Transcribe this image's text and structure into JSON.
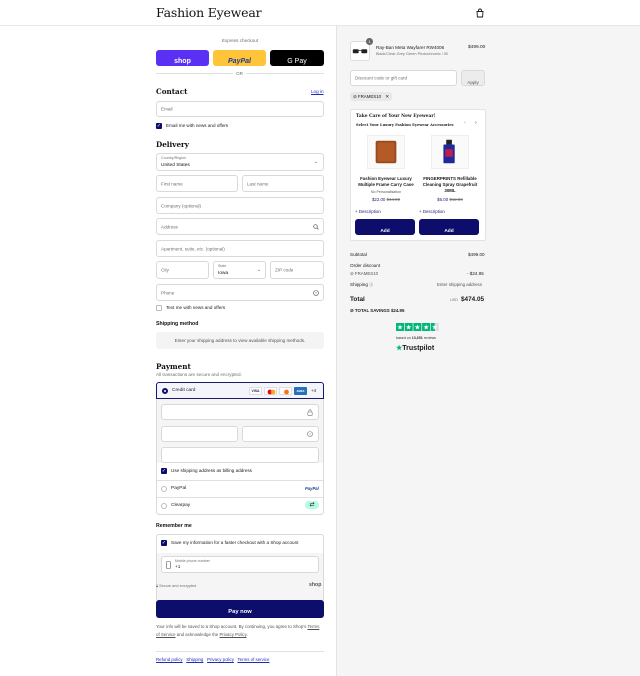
{
  "header": {
    "logo": "Fashion Eyewear",
    "bag_icon": "shopping-bag-icon"
  },
  "express": {
    "label": "Express checkout",
    "shop": "shop",
    "paypal": "PayPal",
    "gpay": "G Pay",
    "or": "OR"
  },
  "contact": {
    "title": "Contact",
    "login": "Log in",
    "email_placeholder": "Email",
    "news_label": "Email me with news and offers"
  },
  "delivery": {
    "title": "Delivery",
    "country_label": "Country/Region",
    "country": "United States",
    "first_name": "First name",
    "last_name": "Last name",
    "company": "Company (optional)",
    "address": "Address",
    "apartment": "Apartment, suite, etc. (optional)",
    "city": "City",
    "state_label": "State",
    "state": "Iowa",
    "zip": "ZIP code",
    "phone": "Phone",
    "text_label": "Text me with news and offers"
  },
  "shipping_method": {
    "title": "Shipping method",
    "note": "Enter your shipping address to view available shipping methods."
  },
  "payment": {
    "title": "Payment",
    "subtitle": "All transactions are secure and encrypted.",
    "credit_card": "Credit card",
    "more_cards": "+4",
    "cards": [
      "VISA",
      "MC",
      "AMEX"
    ],
    "billing_label": "Use shipping address as billing address",
    "paypal": "PayPal",
    "paypal_logo": "PayPal",
    "clearpay": "Clearpay"
  },
  "remember": {
    "title": "Remember me",
    "save_label": "Save my information for a faster checkout with a Shop account",
    "mobile_label": "Mobile phone number",
    "mobile_value": "+1",
    "secure": "Secure and encrypted",
    "shop_logo": "shop"
  },
  "pay_button": "Pay now",
  "disclaimer": {
    "pre": "Your info will be saved to a Shop account. By continuing, you agree to Shop's",
    "tos": "Terms of Service",
    "mid": "and acknowledge the",
    "privacy": "Privacy Policy",
    "end": "."
  },
  "footer_links": [
    "Refund policy",
    "Shipping",
    "Privacy policy",
    "Terms of service"
  ],
  "order": {
    "product": {
      "name": "Ray-Ban Meta Wayfarer RW4006",
      "variant": "Black/Clear-Grey Green Photochromic / 50",
      "price": "$499.00",
      "qty": "1"
    },
    "discount_placeholder": "Discount code or gift card",
    "apply": "Apply",
    "code_tag": "FRAMES10",
    "upsell": {
      "title": "Take Care of Your New Eyewear!",
      "subtitle": "Select Your Luxury Fashion Eyewear Accessories",
      "items": [
        {
          "name": "Fashion Eyewear Luxury Multiple Frame Carry Case",
          "variant": "No Personalisation",
          "price": "$22.00",
          "compare": "$44.00",
          "desc": "Description",
          "add": "Add"
        },
        {
          "name": "FINGERPRINTS Refillable Cleaning Spray Grapefruit 30ML",
          "variant": "",
          "price": "$6.00",
          "compare": "$12.00",
          "desc": "Description",
          "add": "Add"
        }
      ]
    },
    "subtotal_label": "Subtotal",
    "subtotal": "$499.00",
    "order_discount_label": "Order discount",
    "discount_code": "FRAMES10",
    "discount_value": "- $24.95",
    "shipping_label": "Shipping",
    "shipping_value": "Enter shipping address",
    "total_label": "Total",
    "currency": "USD",
    "total": "$474.05",
    "savings_label": "TOTAL SAVINGS",
    "savings_value": "$24.95",
    "trustpilot": {
      "rating_stars": 4.5,
      "based_on_pre": "based on",
      "reviews": "13,651",
      "based_on_post": "reviews",
      "brand": "Trustpilot"
    }
  },
  "colors": {
    "shop": "#5a31f4",
    "paypal": "#ffc439",
    "gpay": "#000000",
    "navy": "#0d0d6b",
    "trust_green": "#00b67a",
    "link": "#1f2bb8"
  }
}
